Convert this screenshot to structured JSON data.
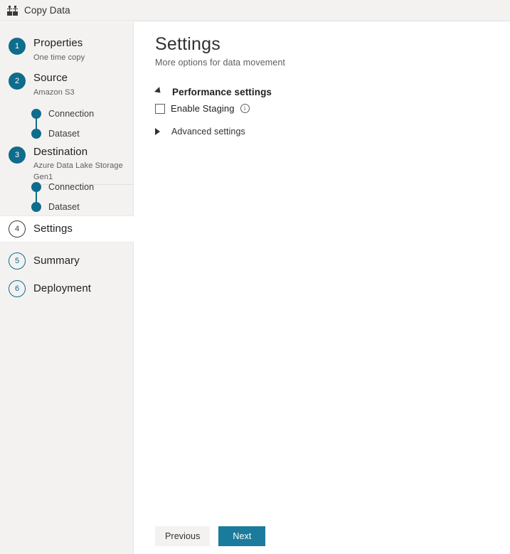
{
  "window": {
    "title": "Copy Data",
    "icon": "copy-data-icon"
  },
  "colors": {
    "accent": "#0f6c8c",
    "primary_button": "#1b7b9c",
    "sidebar_bg": "#f3f2f1",
    "text": "#201f1e",
    "muted_text": "#605e5c"
  },
  "sidebar": {
    "steps": [
      {
        "number": "1",
        "label": "Properties",
        "sublabel": "One time copy",
        "state": "completed",
        "substeps": []
      },
      {
        "number": "2",
        "label": "Source",
        "sublabel": "Amazon S3",
        "state": "completed",
        "substeps": [
          "Connection",
          "Dataset"
        ]
      },
      {
        "number": "3",
        "label": "Destination",
        "sublabel": "Azure Data Lake Storage Gen1",
        "state": "completed",
        "substeps": [
          "Connection",
          "Dataset"
        ]
      },
      {
        "number": "4",
        "label": "Settings",
        "sublabel": "",
        "state": "current",
        "substeps": []
      },
      {
        "number": "5",
        "label": "Summary",
        "sublabel": "",
        "state": "upcoming",
        "substeps": []
      },
      {
        "number": "6",
        "label": "Deployment",
        "sublabel": "",
        "state": "upcoming",
        "substeps": []
      }
    ]
  },
  "main": {
    "title": "Settings",
    "subtitle": "More options for data movement",
    "sections": [
      {
        "title": "Performance settings",
        "expanded": true
      },
      {
        "title": "Advanced settings",
        "expanded": false
      }
    ],
    "enable_staging": {
      "label": "Enable Staging",
      "checked": false,
      "info_icon": "info-icon",
      "info_glyph": "i"
    }
  },
  "footer": {
    "previous_label": "Previous",
    "next_label": "Next"
  }
}
